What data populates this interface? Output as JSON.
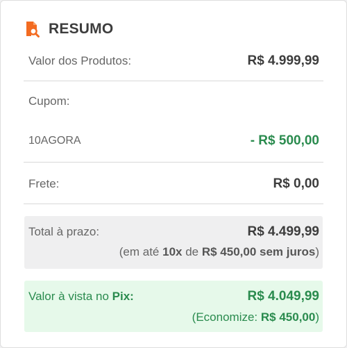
{
  "header": {
    "title": "RESUMO",
    "icon": "document-search-icon",
    "icon_color": "#f36b21"
  },
  "products": {
    "label": "Valor dos Produtos:",
    "value": "R$ 4.999,99"
  },
  "coupon": {
    "label": "Cupom:",
    "code": "10AGORA",
    "discount": "- R$ 500,00"
  },
  "shipping": {
    "label": "Frete:",
    "value": "R$ 0,00"
  },
  "total": {
    "label": "Total à prazo:",
    "value": "R$ 4.499,99",
    "note_open": "(em até ",
    "installments": "10x",
    "note_de": " de ",
    "installment_value": "R$ 450,00 sem juros",
    "note_close": ")"
  },
  "pix": {
    "label_prefix": "Valor à vista no ",
    "label_bold": "Pix:",
    "value": "R$ 4.049,99",
    "note_open": "(Economize: ",
    "savings": "R$ 450,00",
    "note_close": ")"
  },
  "colors": {
    "accent": "#f36b21",
    "green": "#2a8b4e",
    "green_bg": "#e6f9ea",
    "gray_bg": "#efeff0"
  }
}
